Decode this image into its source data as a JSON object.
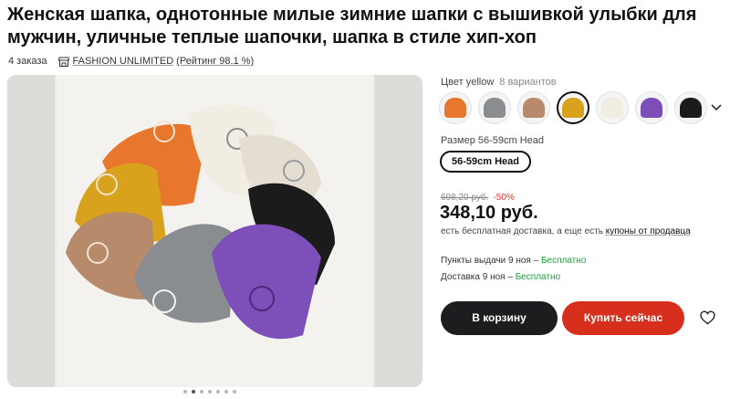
{
  "product": {
    "title": "Женская шапка, однотонные милые зимние шапки с вышивкой улыбки для мужчин, уличные теплые шапочки, шапка в стиле хип-хоп",
    "orders": "4 заказа",
    "store_name": "FASHION UNLIMITED",
    "store_rating": "(Рейтинг 98.1 %)"
  },
  "gallery": {
    "dots_count": 7,
    "active_dot": 1
  },
  "color": {
    "label": "Цвет yellow",
    "variants": "8 вариантов",
    "swatches": [
      {
        "name": "orange",
        "hex": "#e8762c"
      },
      {
        "name": "gray",
        "hex": "#8a8d90"
      },
      {
        "name": "khaki",
        "hex": "#b88a6c"
      },
      {
        "name": "yellow",
        "hex": "#d9a21c",
        "selected": true
      },
      {
        "name": "white",
        "hex": "#f1ede3"
      },
      {
        "name": "purple",
        "hex": "#7d4fb8"
      },
      {
        "name": "black",
        "hex": "#1b1b1b"
      }
    ]
  },
  "size": {
    "label": "Размер 56-59cm Head",
    "selected": "56-59cm Head"
  },
  "price": {
    "old": "698,20 руб.",
    "discount": "-50%",
    "current": "348,10 руб.",
    "note_prefix": "есть бесплатная доставка, а еще есть",
    "note_link": "купоны от продавца"
  },
  "shipping": {
    "pickup_prefix": "Пункты выдачи 9 ноя – ",
    "pickup_free": "Бесплатно",
    "delivery_prefix": "Доставка 9 ноя – ",
    "delivery_free": "Бесплатно"
  },
  "actions": {
    "cart": "В корзину",
    "buy": "Купить сейчас"
  },
  "icons": {
    "store": "store-icon",
    "chevron": "chevron-down-icon",
    "favorite": "heart-icon"
  },
  "colors": {
    "buy_button": "#d62f1e",
    "cart_button": "#1d1d1f",
    "free_text": "#1f9d3f",
    "discount_text": "#e8352e"
  }
}
